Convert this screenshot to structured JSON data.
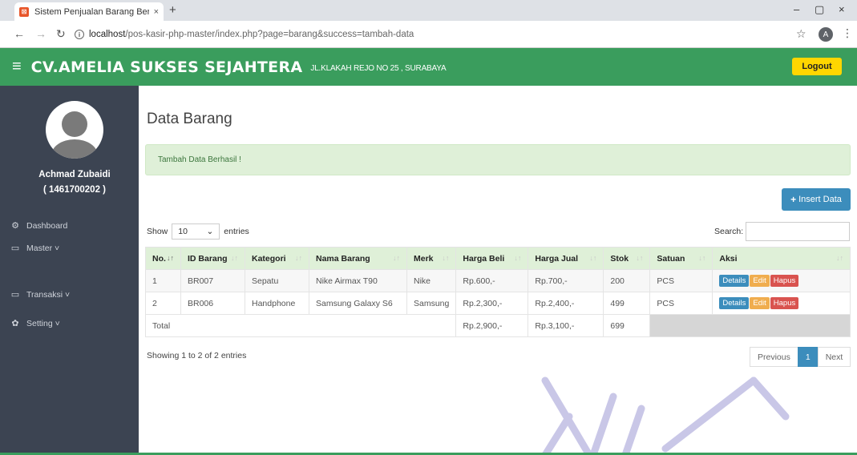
{
  "browser": {
    "tab_title": "Sistem Penjualan Barang Berbas",
    "tab_close": "×",
    "new_tab": "+",
    "url_host": "localhost",
    "url_path": "/pos-kasir-php-master/index.php?page=barang&success=tambah-data",
    "profile_initial": "A",
    "controls": {
      "minimize": "–",
      "maximize": "▢",
      "close": "×"
    }
  },
  "header": {
    "company": "CV.AMELIA SUKSES SEJAHTERA",
    "address": "JL.KLAKAH REJO NO 25 , SURABAYA",
    "logout_label": "Logout"
  },
  "sidebar": {
    "user_name": "Achmad Zubaidi",
    "user_id": "( 1461700202 )",
    "items": [
      {
        "label": "Dashboard",
        "icon": "dashboard-icon"
      },
      {
        "label": "Master ˅",
        "icon": "monitor-icon"
      },
      {
        "label": "Transaksi ˅",
        "icon": "monitor-icon"
      },
      {
        "label": "Setting ˅",
        "icon": "gear-icon"
      }
    ]
  },
  "main": {
    "title": "Data Barang",
    "alert": "Tambah Data Berhasil !",
    "insert_label": "Insert Data",
    "show_label": "Show",
    "entries_value": "10",
    "entries_label": "entries",
    "search_label": "Search:",
    "info": "Showing 1 to 2 of 2 entries",
    "pager": {
      "prev": "Previous",
      "page": "1",
      "next": "Next"
    }
  },
  "table": {
    "columns": [
      "No.",
      "ID Barang",
      "Kategori",
      "Nama Barang",
      "Merk",
      "Harga Beli",
      "Harga Jual",
      "Stok",
      "Satuan",
      "Aksi"
    ],
    "rows": [
      [
        "1",
        "BR007",
        "Sepatu",
        "Nike Airmax T90",
        "Nike",
        "Rp.600,-",
        "Rp.700,-",
        "200",
        "PCS"
      ],
      [
        "2",
        "BR006",
        "Handphone",
        "Samsung Galaxy S6",
        "Samsung",
        "Rp.2,300,-",
        "Rp.2,400,-",
        "499",
        "PCS"
      ]
    ],
    "actions": {
      "details": "Details",
      "edit": "Edit",
      "hapus": "Hapus"
    },
    "total": {
      "label": "Total",
      "harga_beli": "Rp.2,900,-",
      "harga_jual": "Rp.3,100,-",
      "stok": "699"
    }
  },
  "colors": {
    "header_green": "#3a9d5d",
    "sidebar_dark": "#3c4452",
    "alert_green": "#dff0d8",
    "primary_blue": "#3c8dbc",
    "logout_yellow": "#ffd600",
    "edit_orange": "#f0ad4e",
    "hapus_red": "#d9534f"
  }
}
